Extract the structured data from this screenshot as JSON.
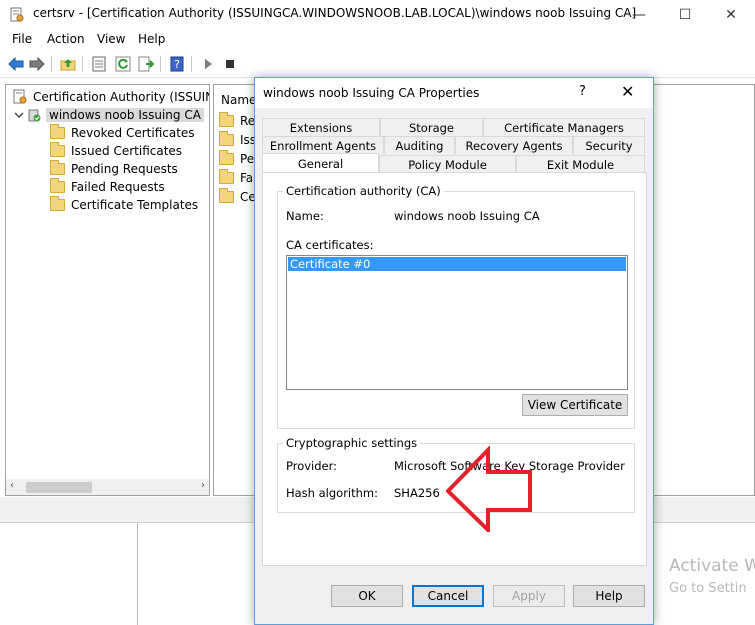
{
  "window": {
    "title": "certsrv - [Certification Authority (ISSUINGCA.WINDOWSNOOB.LAB.LOCAL)\\windows noob Issuing CA]",
    "minimize_glyph": "—",
    "maximize_glyph": "☐",
    "close_glyph": "✕"
  },
  "menu": [
    "File",
    "Action",
    "View",
    "Help"
  ],
  "toolbar": {
    "icons": [
      "back-arrow-icon",
      "forward-arrow-icon",
      "up-folder-icon",
      "properties-icon",
      "refresh-icon",
      "export-list-icon",
      "help-icon",
      "start-service-icon",
      "stop-service-icon"
    ]
  },
  "tree": {
    "root": "Certification Authority (ISSUINGC",
    "ca": "windows noob Issuing CA",
    "items": [
      "Revoked Certificates",
      "Issued Certificates",
      "Pending Requests",
      "Failed Requests",
      "Certificate Templates"
    ]
  },
  "result": {
    "header": "Name",
    "rows": [
      "Rev",
      "Issu",
      "Per",
      "Fail",
      "Cer"
    ]
  },
  "dialog": {
    "title": "windows noob Issuing CA Properties",
    "help_glyph": "?",
    "close_glyph": "✕",
    "tabs_row1": [
      "Extensions",
      "Storage",
      "Certificate Managers"
    ],
    "tabs_row2": [
      "Enrollment Agents",
      "Auditing",
      "Recovery Agents",
      "Security"
    ],
    "tabs_row3": [
      "General",
      "Policy Module",
      "Exit Module"
    ],
    "active_tab": "General",
    "ca_group": {
      "label": "Certification authority (CA)",
      "name_label": "Name:",
      "name_value": "windows noob Issuing CA",
      "certs_label": "CA certificates:",
      "certs": [
        "Certificate #0"
      ],
      "view_button": "View Certificate"
    },
    "crypto_group": {
      "label": "Cryptographic settings",
      "provider_label": "Provider:",
      "provider_value": "Microsoft Software Key Storage Provider",
      "hash_label": "Hash algorithm:",
      "hash_value": "SHA256"
    },
    "buttons": {
      "ok": "OK",
      "cancel": "Cancel",
      "apply": "Apply",
      "help": "Help"
    }
  },
  "watermark": {
    "line1": "Activate W",
    "line2": "Go to Settin"
  },
  "colors": {
    "selection": "#3399ff",
    "annotation_arrow": "#e8202a",
    "dialog_border": "#5f9fd8"
  }
}
